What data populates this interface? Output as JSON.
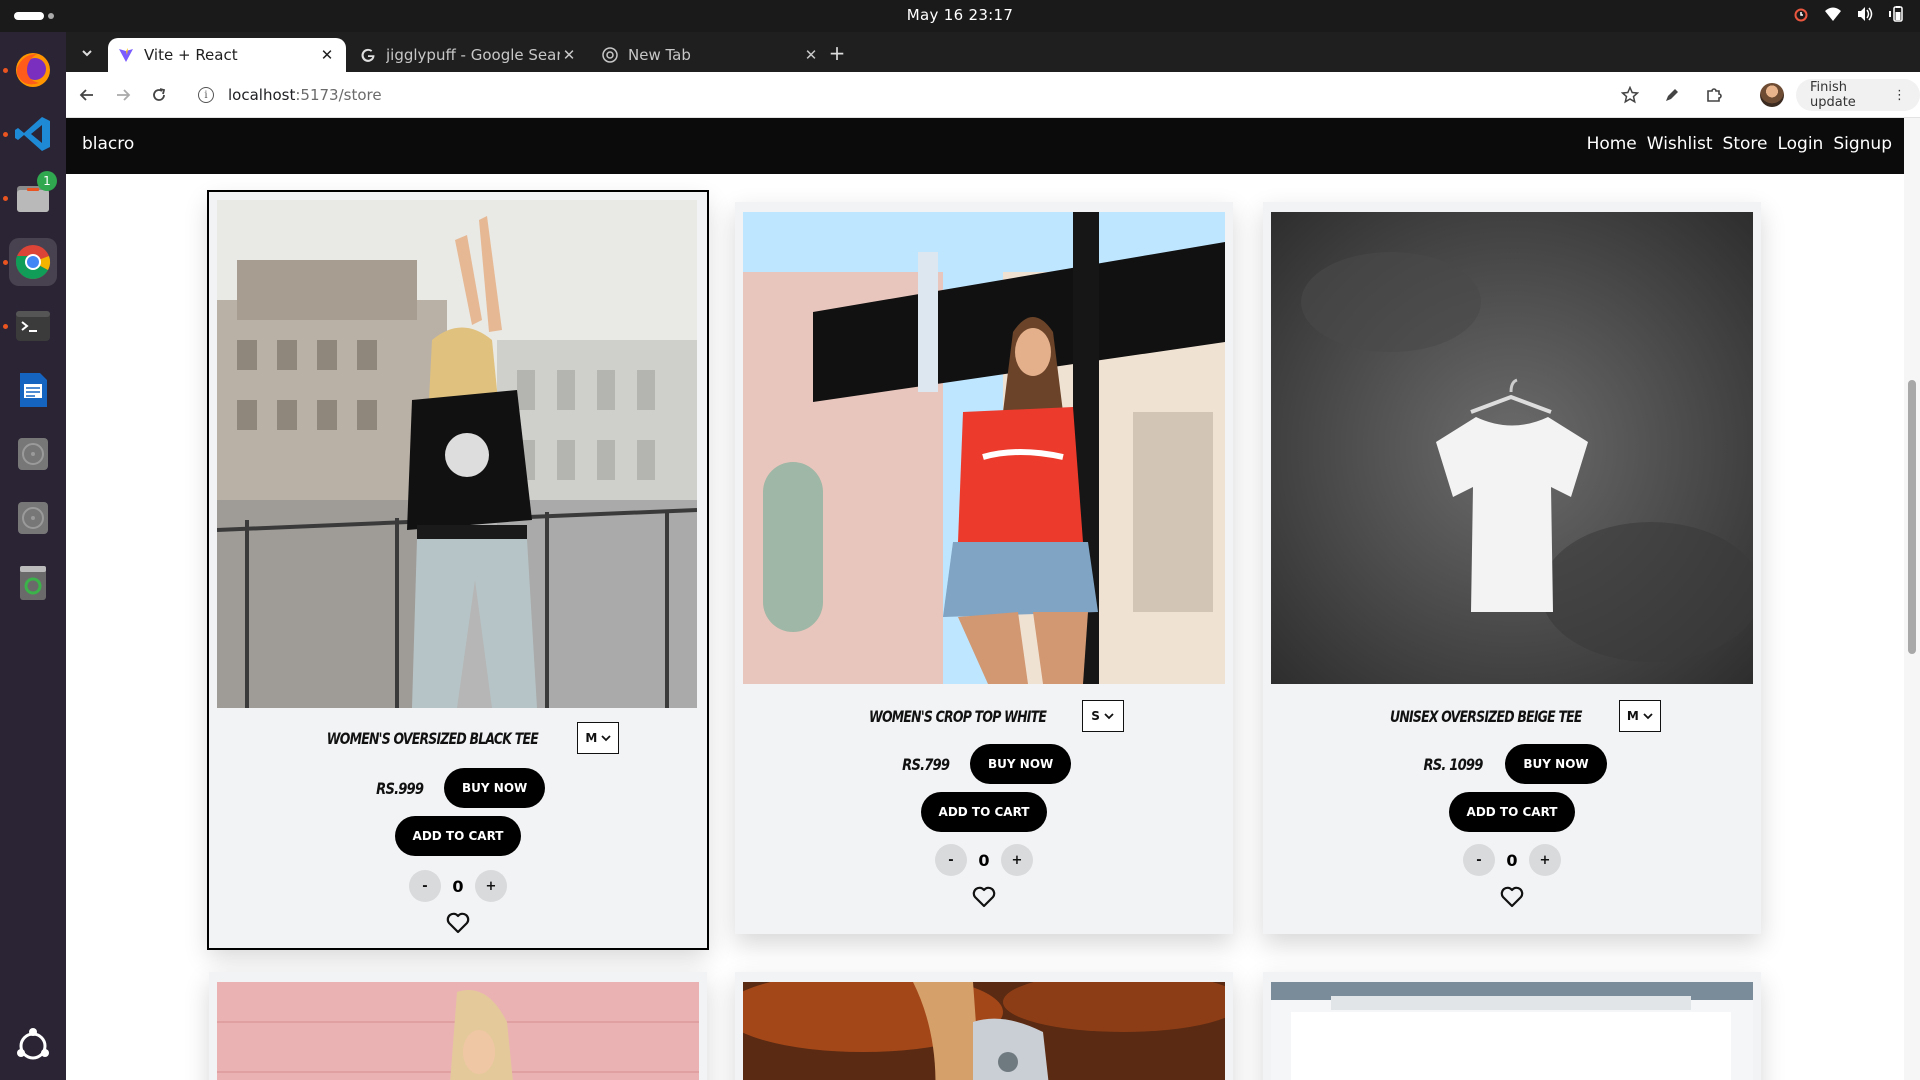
{
  "system": {
    "clock": "May 16  23:17",
    "tray_icons": [
      "alarm-icon",
      "wifi-icon",
      "volume-icon",
      "battery-icon"
    ]
  },
  "dock": {
    "apps": [
      "firefox-icon",
      "vscode-icon",
      "files-icon",
      "chrome-icon",
      "terminal-icon",
      "writer-icon",
      "disk-icon",
      "disk-icon",
      "trash-icon",
      "ubuntu-apps-icon"
    ],
    "files_badge": "1"
  },
  "browser": {
    "tabs": [
      {
        "title": "Vite + React",
        "active": true
      },
      {
        "title": "jigglypuff - Google Search",
        "active": false
      },
      {
        "title": "New Tab",
        "active": false
      }
    ],
    "url_host": "localhost",
    "url_path": ":5173/store",
    "finish_update": "Finish update"
  },
  "site": {
    "brand": "blacro",
    "nav": [
      "Home",
      "Wishlist",
      "Store",
      "Login",
      "Signup"
    ]
  },
  "products": [
    {
      "name": "WOMEN'S OVERSIZED BLACK TEE",
      "size": "M",
      "price": "RS.999",
      "buy": "BUY NOW",
      "cart": "ADD TO CART",
      "qty": "0"
    },
    {
      "name": "WOMEN'S CROP TOP WHITE",
      "size": "S",
      "price": "RS.799",
      "buy": "BUY NOW",
      "cart": "ADD TO CART",
      "qty": "0"
    },
    {
      "name": "UNISEX OVERSIZED BEIGE TEE",
      "size": "M",
      "price": "RS. 1099",
      "buy": "BUY NOW",
      "cart": "ADD TO CART",
      "qty": "0"
    }
  ],
  "qty_minus": "-",
  "qty_plus": "+",
  "colors": {
    "navbar": "#0b0b0b",
    "card": "#f2f3f5",
    "button": "#000000"
  }
}
